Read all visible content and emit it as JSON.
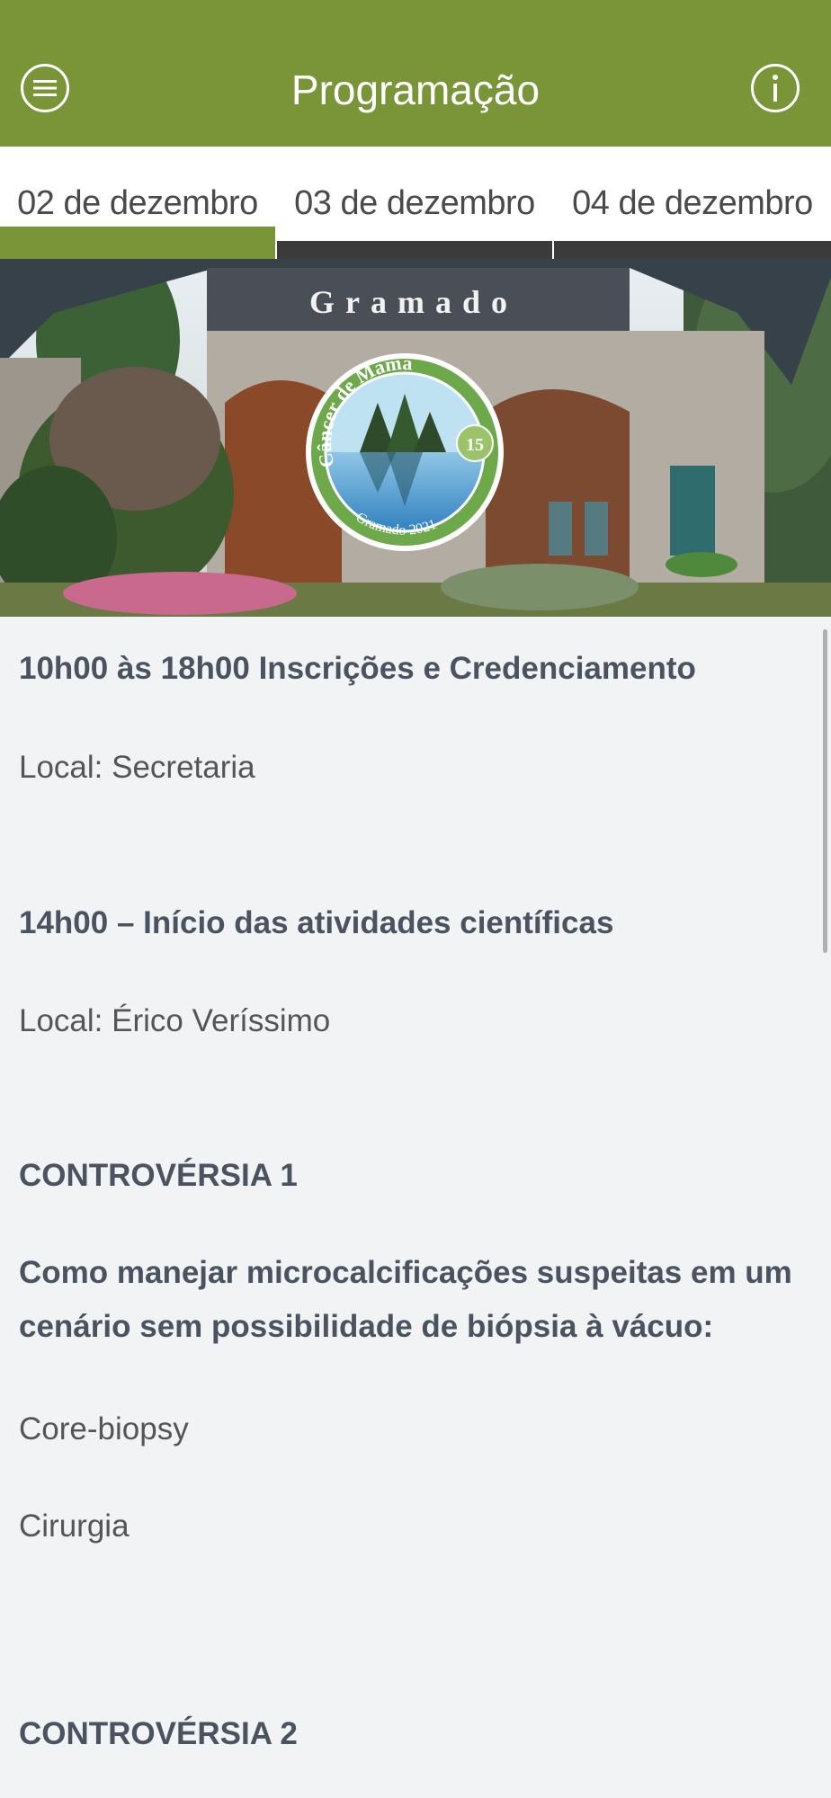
{
  "header": {
    "title": "Programação",
    "menu_icon": "hamburger-icon",
    "info_icon": "info-icon",
    "background_color": "#7a9538"
  },
  "tabs": [
    {
      "label": "02 de dezembro",
      "active": true
    },
    {
      "label": "03 de dezembro",
      "active": false
    },
    {
      "label": "04 de dezembro",
      "active": false
    }
  ],
  "banner": {
    "gate_sign": "Gramado",
    "logo_ring_text": "Câncer de Mama",
    "logo_badge": "15",
    "logo_bottom_text": "Gramado 2021"
  },
  "schedule": {
    "item1_title": "10h00 às 18h00 Inscrições e Credenciamento",
    "item1_place": "Local: Secretaria",
    "item2_title": "14h00 – Início das atividades científicas",
    "item2_place": "Local: Érico Veríssimo",
    "controversy1_title": "CONTROVÉRSIA 1",
    "controversy1_question": "Como manejar microcalcificações suspeitas em um cenário sem possibilidade de biópsia à vácuo:",
    "option1": "Core-biopsy",
    "option2": "Cirurgia",
    "controversy2_title": "CONTROVÉRSIA 2"
  }
}
